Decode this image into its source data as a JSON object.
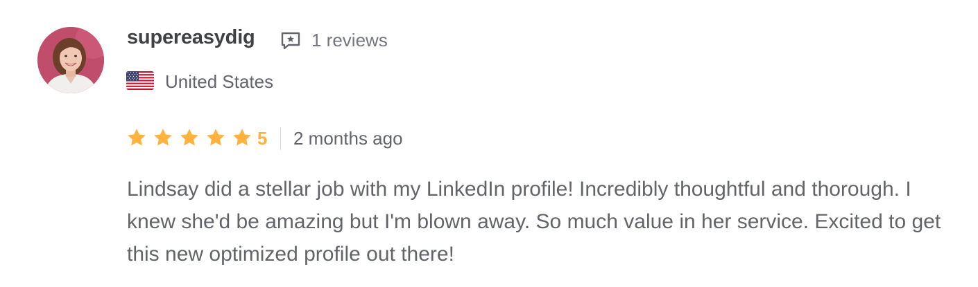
{
  "review": {
    "username": "supereasydig",
    "reviews_count": "1 reviews",
    "reviews_icon": "speech-bubble-star-icon",
    "country": "United States",
    "flag_icon": "us-flag-icon",
    "rating": {
      "stars": 5,
      "max_stars": 5,
      "value": "5",
      "star_icon": "star-icon",
      "star_color": "#ffb33e"
    },
    "time_ago": "2 months ago",
    "text": "Lindsay did a stellar job with my LinkedIn profile! Incredibly thoughtful and thorough. I knew she'd be amazing but I'm blown away. So much value in her service. Excited to get this new optimized profile out there!"
  },
  "colors": {
    "username": "#404145",
    "muted_text": "#62646a",
    "star": "#ffb33e",
    "avatar_bg": "#c14d6c"
  }
}
